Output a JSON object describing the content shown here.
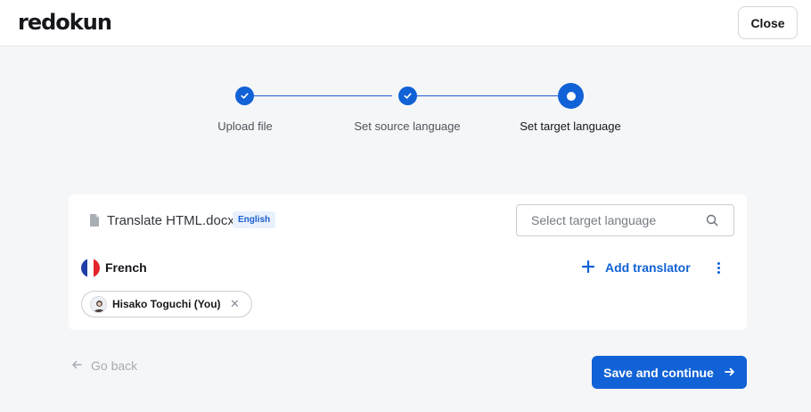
{
  "header": {
    "logo_text": "redokun",
    "close_label": "Close"
  },
  "stepper": {
    "steps": [
      {
        "label": "Upload file",
        "state": "completed"
      },
      {
        "label": "Set source language",
        "state": "completed"
      },
      {
        "label": "Set target language",
        "state": "active"
      }
    ],
    "accent_color": "#1162d6"
  },
  "document": {
    "file_name": "Translate HTML.docx",
    "source_language_badge": "English",
    "target_search_placeholder": "Select target language",
    "target_languages": [
      {
        "name": "French",
        "flag_colors": [
          "#1f3fa8",
          "#ffffff",
          "#e3242b"
        ],
        "add_translator_label": "Add translator",
        "translators": [
          {
            "name": "Hisako Toguchi (You)"
          }
        ]
      }
    ]
  },
  "footer": {
    "go_back_label": "Go back",
    "save_label": "Save and continue"
  }
}
